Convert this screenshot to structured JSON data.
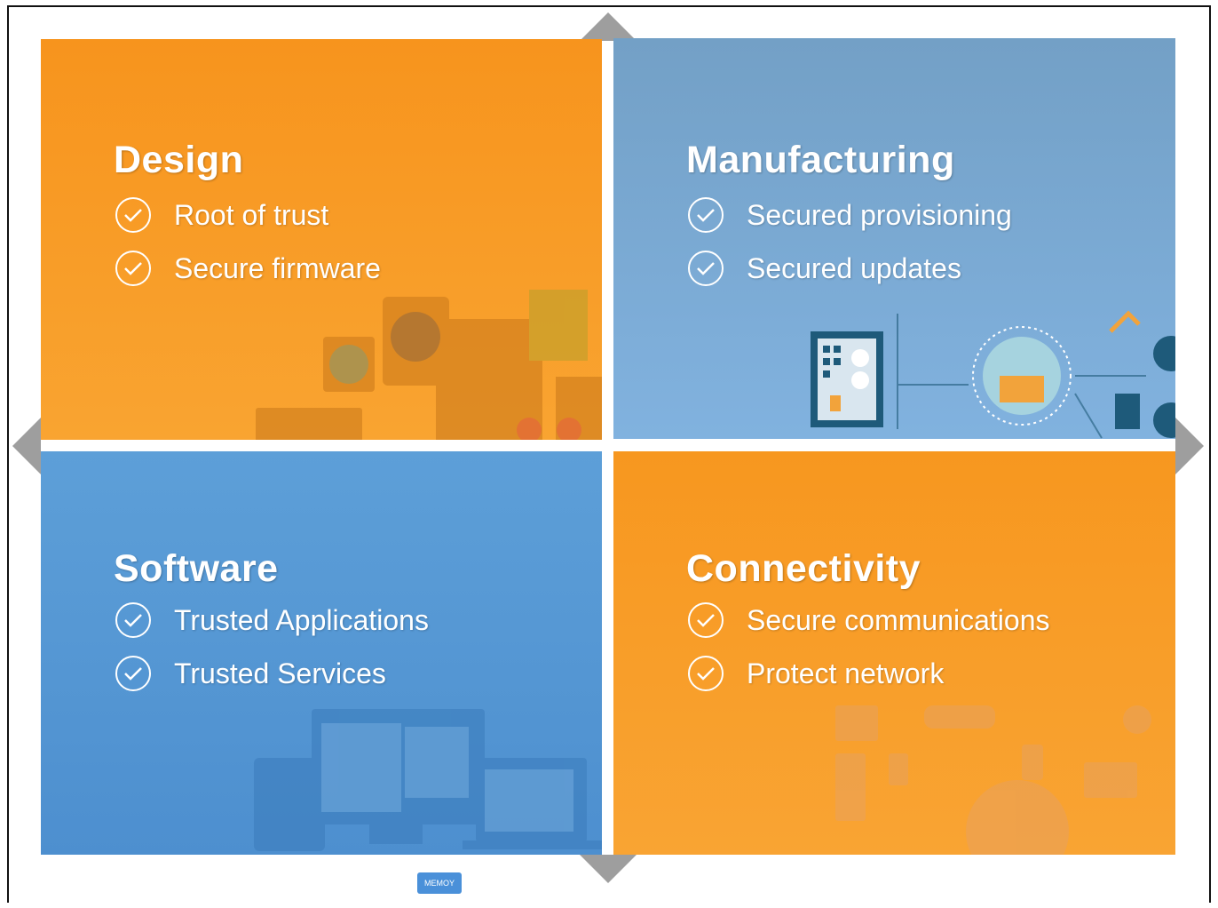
{
  "quadrants": [
    {
      "title": "Design",
      "items": [
        "Root of trust",
        "Secure firmware"
      ]
    },
    {
      "title": "Manufacturing",
      "items": [
        "Secured provisioning",
        "Secured updates"
      ]
    },
    {
      "title": "Software",
      "items": [
        "Trusted Applications",
        "Trusted Services"
      ]
    },
    {
      "title": "Connectivity",
      "items": [
        "Secure communications",
        "Protect network"
      ]
    }
  ],
  "badge": {
    "label": "MEMOY"
  },
  "icons": [
    "check-circle-icon",
    "hardware-icon",
    "factory-icon",
    "computer-icon",
    "iot-devices-icon"
  ],
  "colors": {
    "orange": "#f7941d",
    "blue": "#5d9fd8",
    "steel_blue": "#73a0c6",
    "arrow_gray": "#9e9e9e"
  }
}
